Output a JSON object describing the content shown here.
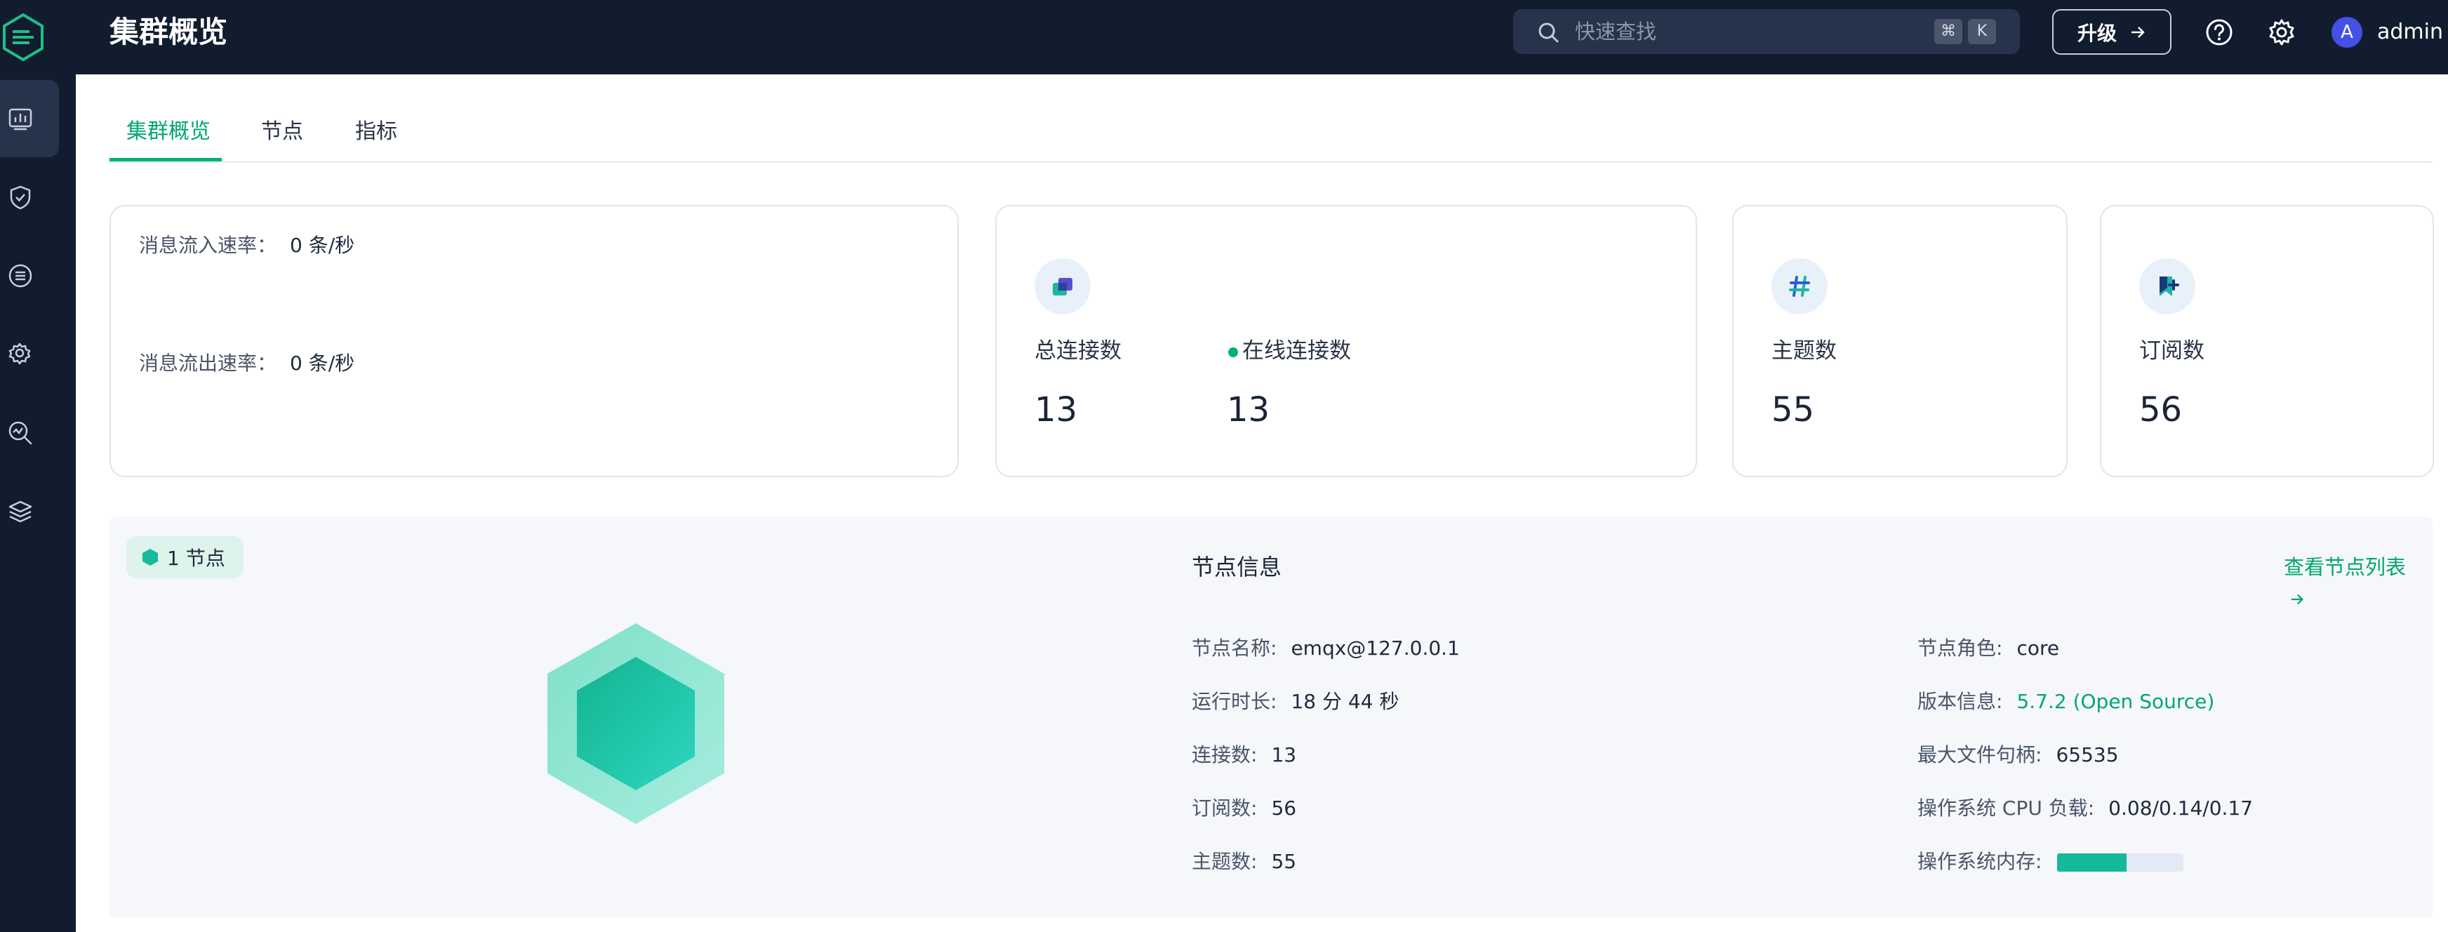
{
  "header": {
    "title": "集群概览",
    "search_placeholder": "快速查找",
    "shortcut_keys": [
      "⌘",
      "K"
    ],
    "upgrade_label": "升级",
    "username": "admin",
    "avatar_initial": "A"
  },
  "sidebar": {
    "items": [
      {
        "icon": "dashboard-icon",
        "active": true
      },
      {
        "icon": "shield-icon",
        "active": false
      },
      {
        "icon": "list-circle-icon",
        "active": false
      },
      {
        "icon": "gear-hand-icon",
        "active": false
      },
      {
        "icon": "search-chart-icon",
        "active": false
      },
      {
        "icon": "layers-icon",
        "active": false
      }
    ]
  },
  "tabs": [
    {
      "label": "集群概览",
      "active": true
    },
    {
      "label": "节点",
      "active": false
    },
    {
      "label": "指标",
      "active": false
    }
  ],
  "rates": {
    "in_label": "消息流入速率：",
    "in_value": "0 条/秒",
    "out_label": "消息流出速率：",
    "out_value": "0 条/秒"
  },
  "stats": {
    "connections": {
      "label": "总连接数",
      "value": "13",
      "icon": "connections-icon"
    },
    "online_connections": {
      "label": "在线连接数",
      "value": "13"
    },
    "topics": {
      "label": "主题数",
      "value": "55",
      "icon": "hash-icon"
    },
    "subscriptions": {
      "label": "订阅数",
      "value": "56",
      "icon": "bookmark-plus-icon"
    }
  },
  "node": {
    "badge_label": "1 节点",
    "info_title": "节点信息",
    "view_list_label": "查看节点列表",
    "left_rows": [
      {
        "key": "节点名称:",
        "value": "emqx@127.0.0.1"
      },
      {
        "key": "运行时长:",
        "value": "18 分 44 秒"
      },
      {
        "key": "连接数:",
        "value": "13"
      },
      {
        "key": "订阅数:",
        "value": "56"
      },
      {
        "key": "主题数:",
        "value": "55"
      }
    ],
    "right_rows": [
      {
        "key": "节点角色:",
        "value": "core"
      },
      {
        "key": "版本信息:",
        "value": "5.7.2 (Open Source)"
      },
      {
        "key": "最大文件句柄:",
        "value": "65535"
      },
      {
        "key": "操作系统 CPU 负载:",
        "value": "0.08/0.14/0.17"
      },
      {
        "key": "操作系统内存:",
        "value": ""
      }
    ],
    "memory_usage_fraction": 0.55
  },
  "colors": {
    "accent": "#00b173",
    "topbar": "#111c2e",
    "memory_fill": "#14b89a"
  }
}
